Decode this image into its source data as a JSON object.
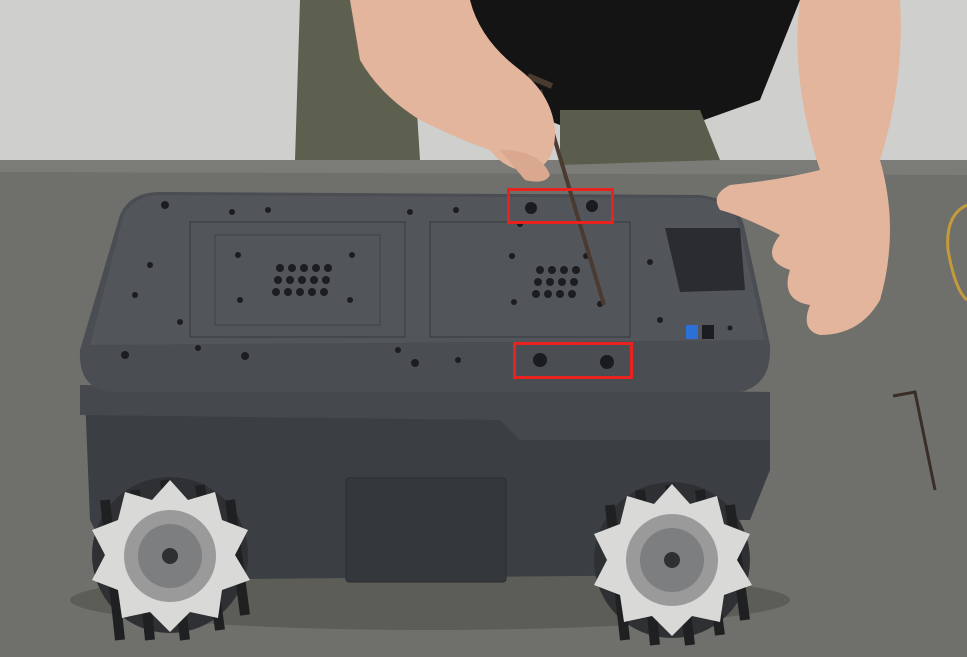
{
  "scene": {
    "subject": "mecanum-wheel-robot-chassis",
    "colors": {
      "wall": "#cfcfcd",
      "table": "#6f706c",
      "chassis_top": "#4a4d52",
      "chassis_body": "#3b3e43",
      "wheel_roller": "#2f3033",
      "wheel_hub": "#9a9a9a",
      "skin": "#e2b59c",
      "shirt": "#141414",
      "pants": "#5e604f",
      "highlight": "#e8231f",
      "hex_key": "#4a3a30"
    }
  },
  "annotations": [
    {
      "name": "mounting-holes-top"
    },
    {
      "name": "mounting-holes-bottom"
    }
  ]
}
